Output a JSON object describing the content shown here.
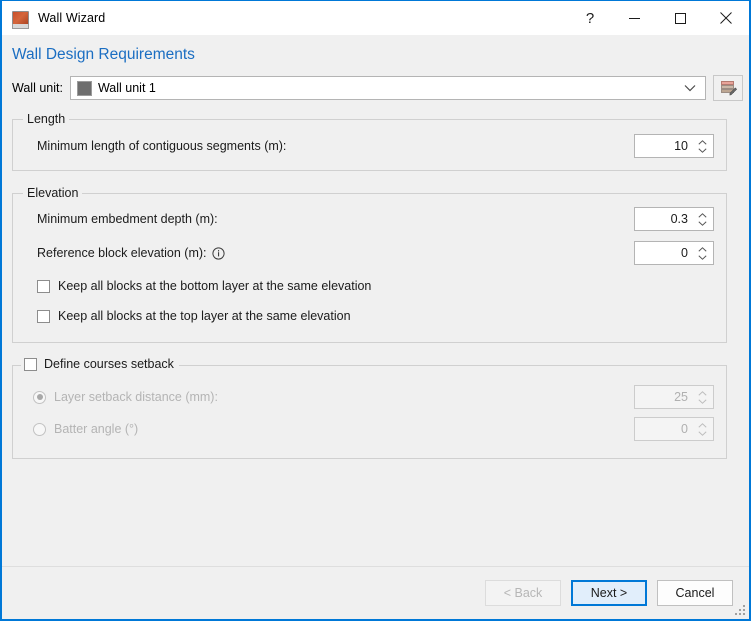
{
  "window": {
    "title": "Wall Wizard",
    "icon": "wall-block-icon",
    "controls": {
      "help": "?",
      "minimize": "minimize-icon",
      "maximize": "maximize-icon",
      "close": "close-icon"
    },
    "accent_color": "#0078d7",
    "background_color": "#f0f0f0"
  },
  "page": {
    "title": "Wall Design Requirements",
    "title_color": "#1b6ec2"
  },
  "wall_unit": {
    "label": "Wall unit:",
    "selected": "Wall unit 1",
    "swatch_color": "#6e6e6e",
    "dropdown_icon": "chevron-down-icon",
    "edit_button_icon": "edit-wall-unit-icon"
  },
  "length_group": {
    "legend": "Length",
    "min_segment_length": {
      "label": "Minimum length of contiguous segments (m):",
      "value": "10"
    }
  },
  "elevation_group": {
    "legend": "Elevation",
    "min_embedment_depth": {
      "label": "Minimum embedment depth (m):",
      "value": "0.3"
    },
    "reference_block_elevation": {
      "label": "Reference block elevation (m):",
      "info_icon": "info-icon",
      "value": "0"
    },
    "keep_bottom": {
      "label": "Keep all blocks at the bottom layer at the same elevation",
      "checked": false
    },
    "keep_top": {
      "label": "Keep all blocks at the top layer at the same elevation",
      "checked": false
    }
  },
  "setback_group": {
    "legend": "Define courses setback",
    "enabled": false,
    "layer_setback_distance": {
      "label": "Layer setback distance (mm):",
      "value": "25",
      "selected": true
    },
    "batter_angle": {
      "label": "Batter angle (°)",
      "value": "0",
      "selected": false
    }
  },
  "footer": {
    "back": "< Back",
    "next": "Next >",
    "cancel": "Cancel",
    "resize_grip": "resize-grip-icon"
  }
}
